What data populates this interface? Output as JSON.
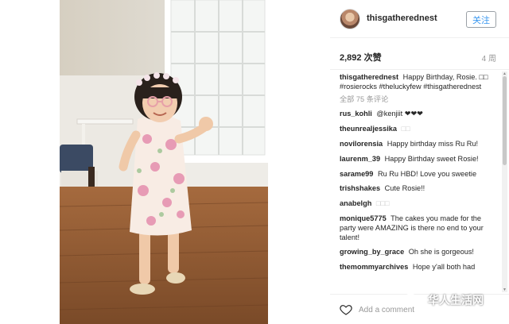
{
  "post": {
    "username": "thisgatherednest",
    "follow_label": "关注",
    "likes": "2,892 次赞",
    "time_ago": "4 周",
    "caption": {
      "user": "thisgatherednest",
      "text": "Happy Birthday, Rosie. □□ #rosierocks #theluckyfew #thisgatherednest"
    },
    "see_all": "全部 75 条评论",
    "comments": [
      {
        "user": "rus_kohli",
        "text": "@kenjiit ❤❤❤"
      },
      {
        "user": "theunrealjessika",
        "text": "□□"
      },
      {
        "user": "novilorensia",
        "text": "Happy birthday miss Ru Ru!"
      },
      {
        "user": "laurenm_39",
        "text": "Happy Birthday sweet Rosie!"
      },
      {
        "user": "sarame99",
        "text": "Ru Ru HBD! Love you sweetie"
      },
      {
        "user": "trishshakes",
        "text": "Cute Rosie!!"
      },
      {
        "user": "anabelgh",
        "text": "□□□"
      },
      {
        "user": "monique5775",
        "text": "The cakes you made for the party were AMAZING is there no end to your talent!"
      },
      {
        "user": "growing_by_grace",
        "text": "Oh she is gorgeous!"
      },
      {
        "user": "themommyarchives",
        "text": "Hope y'all both had"
      }
    ],
    "add_comment_placeholder": "Add a comment..."
  },
  "watermark": {
    "text": "华人生活网"
  },
  "icons": {
    "avatar": "avatar",
    "heart": "heart-icon",
    "watermark": "wechat-logo-icon"
  },
  "colors": {
    "follow": "#3897f0",
    "muted": "#999999",
    "text": "#262626"
  }
}
